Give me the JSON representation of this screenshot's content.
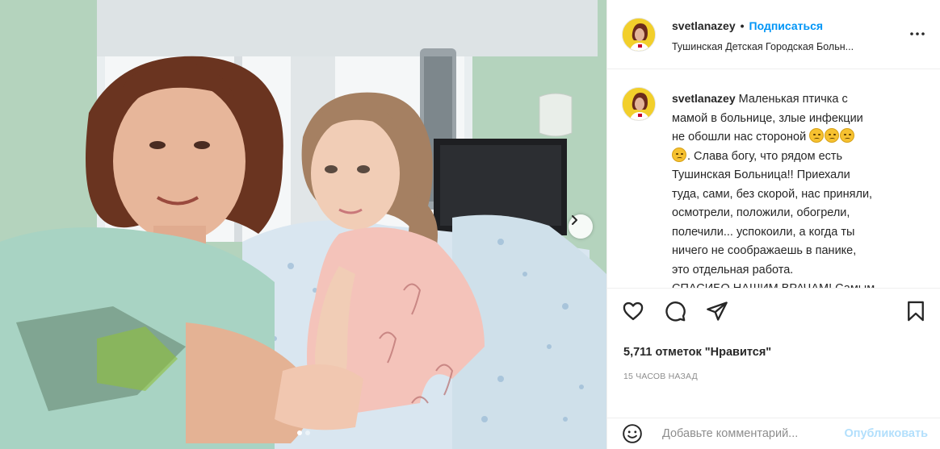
{
  "post": {
    "username": "svetlanazey",
    "separator": "•",
    "follow_label": "Подписаться",
    "location": "Тушинская Детская Городская Больн...",
    "caption_lines": [
      "Маленькая птичка с",
      "мамой в больнице, злые инфекции",
      "не обошли нас стороной",
      ". Слава богу, что рядом есть",
      "Тушинская Больница!! Приехали",
      "туда, сами, без скорой, нас приняли,",
      "осмотрели, положили, обогрели,",
      "полечили... успокоили, а когда ты",
      "ничего не соображаешь в панике,",
      "это отдельная работа.",
      "СПАСИБО НАШИМ ВРАЧАМ! Самым"
    ],
    "caption_emojis": [
      "sad-face",
      "disappointed-face",
      "disappointed-face",
      "disappointed-face"
    ],
    "likes_text": "5,711 отметок \"Нравится\"",
    "time_text": "15 ЧАСОВ НАЗАД"
  },
  "carousel": {
    "slide_count": 2,
    "active_index": 0
  },
  "comment_box": {
    "placeholder": "Добавьте комментарий...",
    "publish_label": "Опубликовать"
  },
  "icons": {
    "more": "more-horizontal-icon",
    "like": "heart-icon",
    "comment": "comment-bubble-icon",
    "share": "paper-plane-icon",
    "save": "bookmark-icon",
    "emoji": "smiley-icon",
    "next": "chevron-right-icon"
  },
  "colors": {
    "accent": "#0095f6",
    "publish_disabled": "#b2dffc",
    "text": "#262626",
    "muted": "#8e8e8e",
    "border": "#efefef",
    "avatar_bg": "#f2cf2b"
  }
}
